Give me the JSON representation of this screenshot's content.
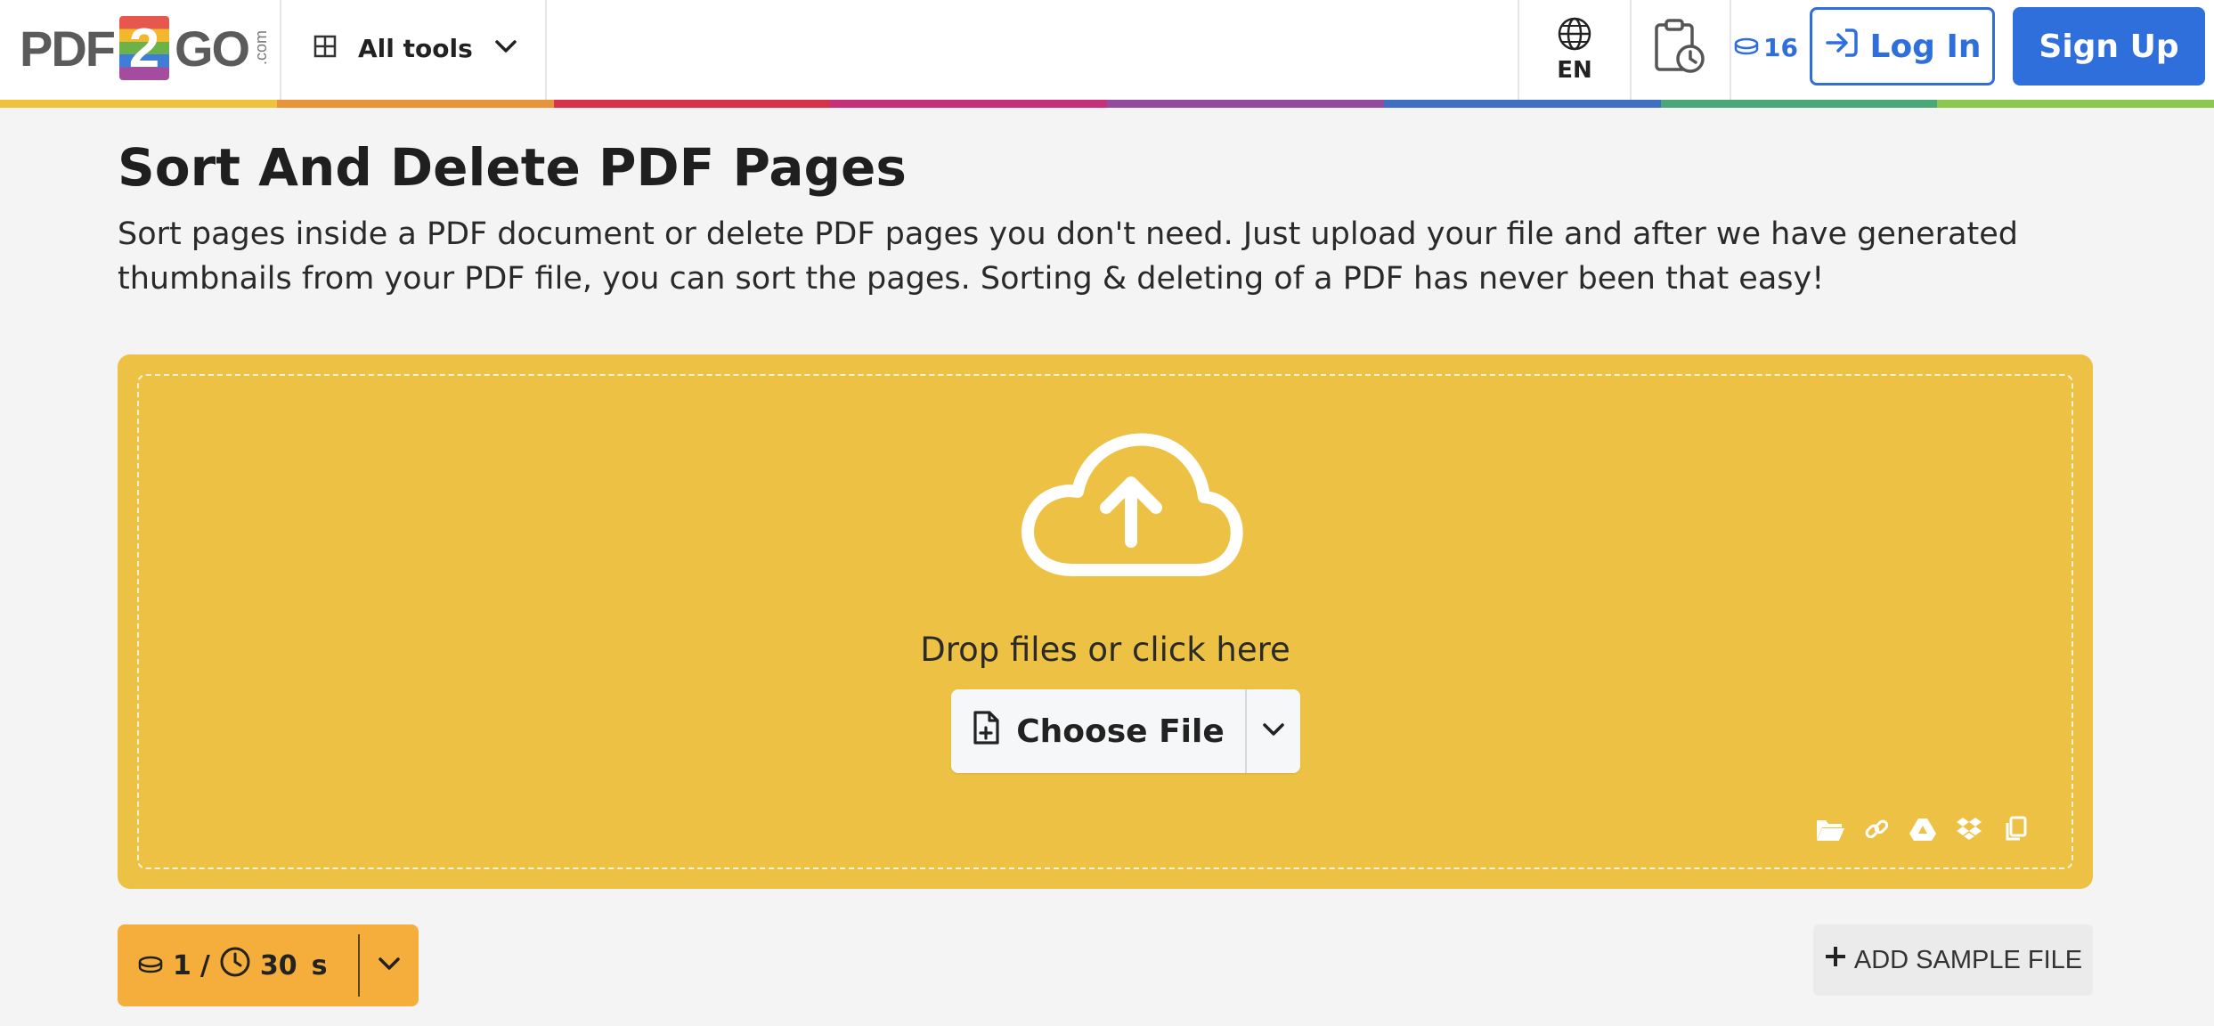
{
  "header": {
    "logo": {
      "left": "PDF",
      "box": "2",
      "right": "GO",
      "suffix": ".com"
    },
    "all_tools_label": "All tools",
    "language_label": "EN",
    "credits_count": "16",
    "login_label": "Log In",
    "signup_label": "Sign Up",
    "rainbow_colors": [
      "#f0c23c",
      "#e8953a",
      "#d9334a",
      "#c63078",
      "#944a9e",
      "#3f6fc4",
      "#4aa878",
      "#8cc84e"
    ]
  },
  "main": {
    "title": "Sort And Delete PDF Pages",
    "description": "Sort pages inside a PDF document or delete PDF pages you don't need. Just upload your file and after we have generated thumbnails from your PDF file, you can sort the pages. Sorting & deleting of a PDF has never been that easy!"
  },
  "dropzone": {
    "prompt": "Drop files or click here",
    "choose_file_label": "Choose File",
    "source_icons": [
      "folder-icon",
      "link-icon",
      "google-drive-icon",
      "dropbox-icon",
      "clipboard-icon"
    ]
  },
  "cost": {
    "credits": "1",
    "separator": "/",
    "time": "30",
    "time_unit": "s"
  },
  "sample": {
    "label": "ADD SAMPLE FILE"
  },
  "colors": {
    "accent_blue": "#2f6fdc",
    "dropzone_yellow": "#edc143",
    "cost_orange": "#f5ae3c"
  }
}
